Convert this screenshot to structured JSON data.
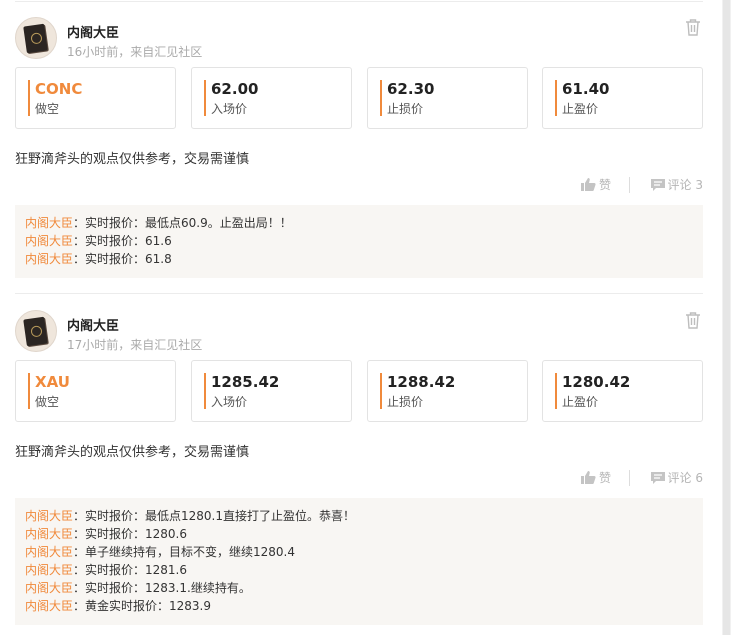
{
  "posts": [
    {
      "username": "内阁大臣",
      "meta": "16小时前，来自汇见社区",
      "symbol": "CONC",
      "direction": "做空",
      "entry": {
        "value": "62.00",
        "label": "入场价"
      },
      "stop_loss": {
        "value": "62.30",
        "label": "止损价"
      },
      "take_profit": {
        "value": "61.40",
        "label": "止盈价"
      },
      "description": "狂野滴斧头的观点仅供参考，交易需谨慎",
      "like_label": "赞",
      "comment_label": "评论 3",
      "replies": [
        {
          "author": "内阁大臣",
          "text": "：实时报价：最低点60.9。止盈出局！！"
        },
        {
          "author": "内阁大臣",
          "text": "：实时报价：61.6"
        },
        {
          "author": "内阁大臣",
          "text": "：实时报价：61.8"
        }
      ]
    },
    {
      "username": "内阁大臣",
      "meta": "17小时前，来自汇见社区",
      "symbol": "XAU",
      "direction": "做空",
      "entry": {
        "value": "1285.42",
        "label": "入场价"
      },
      "stop_loss": {
        "value": "1288.42",
        "label": "止损价"
      },
      "take_profit": {
        "value": "1280.42",
        "label": "止盈价"
      },
      "description": "狂野滴斧头的观点仅供参考，交易需谨慎",
      "like_label": "赞",
      "comment_label": "评论 6",
      "replies": [
        {
          "author": "内阁大臣",
          "text": "：实时报价：最低点1280.1直接打了止盈位。恭喜！"
        },
        {
          "author": "内阁大臣",
          "text": "：实时报价：1280.6"
        },
        {
          "author": "内阁大臣",
          "text": "：单子继续持有，目标不变，继续1280.4"
        },
        {
          "author": "内阁大臣",
          "text": "：实时报价：1281.6"
        },
        {
          "author": "内阁大臣",
          "text": "：实时报价：1283.1.继续持有。"
        },
        {
          "author": "内阁大臣",
          "text": "：黄金实时报价：1283.9"
        }
      ]
    }
  ],
  "colors": {
    "accent": "#f08a3c",
    "muted": "#aaaaaa",
    "reply_bg": "#f8f6f3"
  },
  "icons": {
    "delete": "trash-icon",
    "like": "thumbs-up-icon",
    "comment": "comment-icon"
  }
}
